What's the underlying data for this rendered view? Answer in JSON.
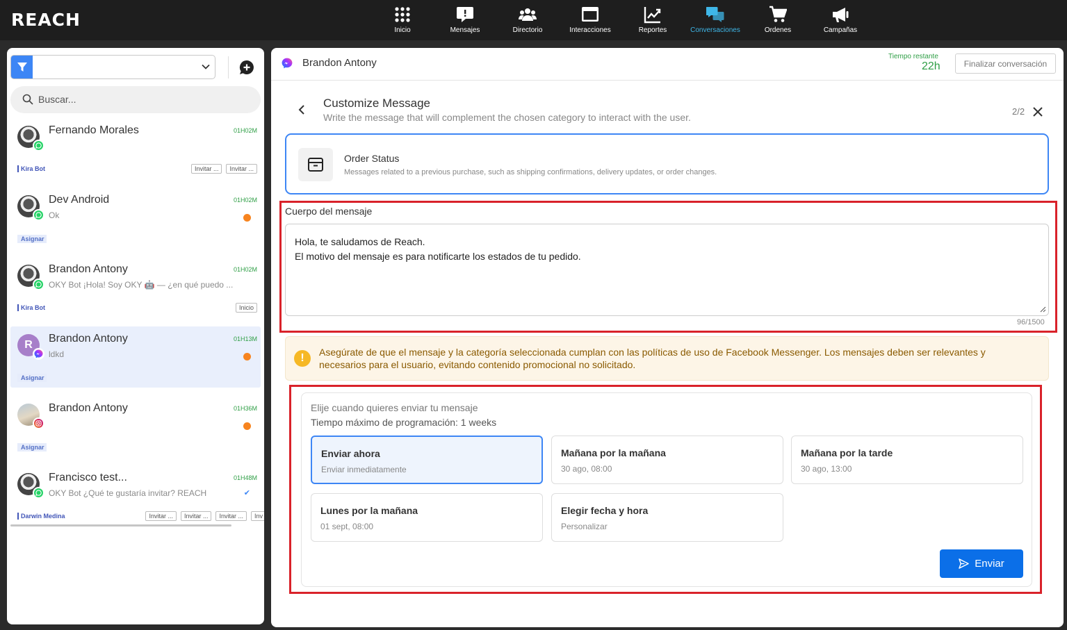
{
  "app": {
    "logo": "REACH"
  },
  "nav": [
    {
      "label": "Inicio",
      "icon": "grid-icon"
    },
    {
      "label": "Mensajes",
      "icon": "message-icon"
    },
    {
      "label": "Directorio",
      "icon": "users-icon"
    },
    {
      "label": "Interacciones",
      "icon": "window-icon"
    },
    {
      "label": "Reportes",
      "icon": "chart-icon"
    },
    {
      "label": "Conversaciones",
      "icon": "conversations-icon",
      "active": true
    },
    {
      "label": "Ordenes",
      "icon": "cart-icon"
    },
    {
      "label": "Campañas",
      "icon": "megaphone-icon"
    }
  ],
  "sidebar": {
    "search_placeholder": "Buscar...",
    "conversations": [
      {
        "name": "Fernando Morales",
        "time": "01H02M",
        "message": "",
        "channel": "whatsapp",
        "tag": "Kira Bot",
        "chips": [
          "Invitar ...",
          "Invitar ..."
        ]
      },
      {
        "name": "Dev Android",
        "time": "01H02M",
        "message": "Ok",
        "channel": "whatsapp",
        "tag": "Asignar",
        "unread": true
      },
      {
        "name": "Brandon Antony",
        "time": "01H02M",
        "message": "OKY Bot ¡Hola! Soy OKY 🤖 — ¿en qué puedo ...",
        "channel": "whatsapp",
        "tag": "Kira Bot",
        "chips": [
          "Inicio"
        ]
      },
      {
        "name": "Brandon Antony",
        "time": "01H13M",
        "message": "ldkd",
        "channel": "messenger",
        "tag": "Asignar",
        "unread": true,
        "selected": true,
        "avatar_letter": "R"
      },
      {
        "name": "Brandon Antony",
        "time": "01H36M",
        "message": "",
        "channel": "instagram",
        "tag": "Asignar",
        "unread": true
      },
      {
        "name": "Francisco test...",
        "time": "01H48M",
        "message": "OKY Bot ¿Qué te gustaría invitar? REACH",
        "channel": "whatsapp",
        "tag": "Darwin Medina",
        "chips": [
          "Invitar ...",
          "Invitar ...",
          "Invitar ...",
          "Inv"
        ]
      }
    ]
  },
  "chat": {
    "contact_name": "Brandon Antony",
    "time_label": "Tiempo restante",
    "time_value": "22h",
    "end_button": "Finalizar conversación"
  },
  "customize": {
    "title": "Customize Message",
    "subtitle": "Write the message that will complement the chosen category to interact with the user.",
    "step": "2/2",
    "category": {
      "title": "Order Status",
      "description": "Messages related to a previous purchase, such as shipping confirmations, delivery updates, or order changes."
    },
    "body_label": "Cuerpo del mensaje",
    "body_text": "Hola, te saludamos de Reach.\nEl motivo del mensaje es para notificarte los estados de tu pedido.",
    "counter": "96/1500",
    "warning": "Asegúrate de que el mensaje y la categoría seleccionada cumplan con las políticas de uso de Facebook Messenger. Los mensajes deben ser relevantes y necesarios para el usuario, evitando contenido promocional no solicitado."
  },
  "schedule": {
    "label": "Elije cuando quieres enviar tu mensaje",
    "max_label": "Tiempo máximo de programación: 1 weeks",
    "options": [
      {
        "title": "Enviar ahora",
        "subtitle": "Enviar inmediatamente",
        "selected": true
      },
      {
        "title": "Mañana por la mañana",
        "subtitle": "30 ago, 08:00"
      },
      {
        "title": "Mañana por la tarde",
        "subtitle": "30 ago, 13:00"
      },
      {
        "title": "Lunes por la mañana",
        "subtitle": "01 sept, 08:00"
      },
      {
        "title": "Elegir fecha y hora",
        "subtitle": "Personalizar"
      }
    ],
    "send_label": "Enviar"
  },
  "colors": {
    "accent": "#3d86f5",
    "active_nav": "#3fb7e8",
    "timer": "#2e9e45",
    "unread": "#f7841f",
    "highlight": "#d9222a",
    "send_button": "#0b6fe8"
  }
}
